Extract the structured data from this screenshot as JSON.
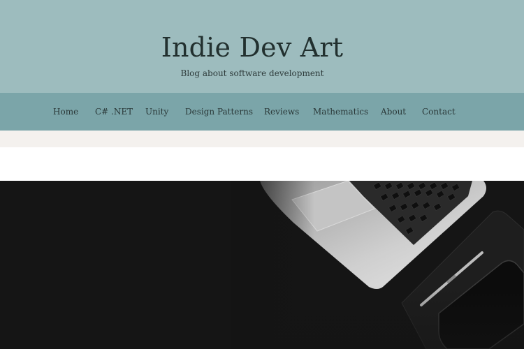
{
  "site": {
    "title": "Indie Dev Art",
    "tagline": "Blog about software development"
  },
  "nav": {
    "items": [
      {
        "label": "Home"
      },
      {
        "label": "C# .NET"
      },
      {
        "label": "Unity"
      },
      {
        "label": "Design Patterns"
      },
      {
        "label": "Reviews"
      },
      {
        "label": "Mathematics"
      },
      {
        "label": "About"
      },
      {
        "label": "Contact"
      }
    ]
  },
  "colors": {
    "header_bg": "#9dbcbe",
    "nav_bg": "#7ba5a9",
    "band_bg": "#f4f1ee",
    "hero_bg": "#141414"
  },
  "hero": {
    "image": "laptop-desk-photo"
  }
}
